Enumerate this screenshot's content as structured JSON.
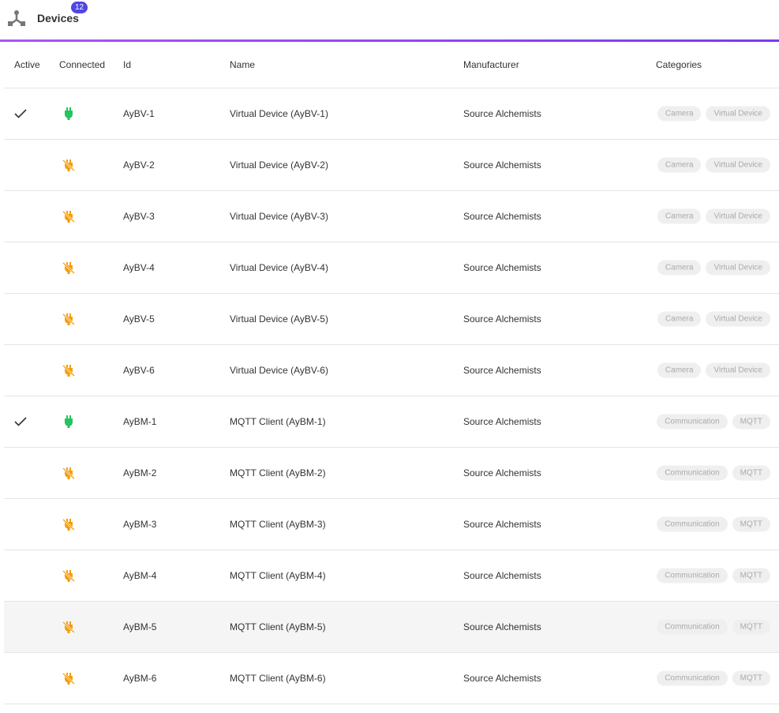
{
  "header": {
    "title": "Devices",
    "count": "12",
    "icon": "device-hub-icon"
  },
  "colors": {
    "accent": "#a855f7",
    "badge": "#4f46e5",
    "connected": "#22c55e",
    "disconnected": "#f59e0b"
  },
  "columns": [
    "Active",
    "Connected",
    "Id",
    "Name",
    "Manufacturer",
    "Categories"
  ],
  "rows": [
    {
      "active": true,
      "connected": true,
      "id": "AyBV-1",
      "name": "Virtual Device (AyBV-1)",
      "manufacturer": "Source Alchemists",
      "categories": [
        "Camera",
        "Virtual Device"
      ]
    },
    {
      "active": false,
      "connected": false,
      "id": "AyBV-2",
      "name": "Virtual Device (AyBV-2)",
      "manufacturer": "Source Alchemists",
      "categories": [
        "Camera",
        "Virtual Device"
      ]
    },
    {
      "active": false,
      "connected": false,
      "id": "AyBV-3",
      "name": "Virtual Device (AyBV-3)",
      "manufacturer": "Source Alchemists",
      "categories": [
        "Camera",
        "Virtual Device"
      ]
    },
    {
      "active": false,
      "connected": false,
      "id": "AyBV-4",
      "name": "Virtual Device (AyBV-4)",
      "manufacturer": "Source Alchemists",
      "categories": [
        "Camera",
        "Virtual Device"
      ]
    },
    {
      "active": false,
      "connected": false,
      "id": "AyBV-5",
      "name": "Virtual Device (AyBV-5)",
      "manufacturer": "Source Alchemists",
      "categories": [
        "Camera",
        "Virtual Device"
      ]
    },
    {
      "active": false,
      "connected": false,
      "id": "AyBV-6",
      "name": "Virtual Device (AyBV-6)",
      "manufacturer": "Source Alchemists",
      "categories": [
        "Camera",
        "Virtual Device"
      ]
    },
    {
      "active": true,
      "connected": true,
      "id": "AyBM-1",
      "name": "MQTT Client (AyBM-1)",
      "manufacturer": "Source Alchemists",
      "categories": [
        "Communication",
        "MQTT"
      ]
    },
    {
      "active": false,
      "connected": false,
      "id": "AyBM-2",
      "name": "MQTT Client (AyBM-2)",
      "manufacturer": "Source Alchemists",
      "categories": [
        "Communication",
        "MQTT"
      ]
    },
    {
      "active": false,
      "connected": false,
      "id": "AyBM-3",
      "name": "MQTT Client (AyBM-3)",
      "manufacturer": "Source Alchemists",
      "categories": [
        "Communication",
        "MQTT"
      ]
    },
    {
      "active": false,
      "connected": false,
      "id": "AyBM-4",
      "name": "MQTT Client (AyBM-4)",
      "manufacturer": "Source Alchemists",
      "categories": [
        "Communication",
        "MQTT"
      ]
    },
    {
      "active": false,
      "connected": false,
      "id": "AyBM-5",
      "name": "MQTT Client (AyBM-5)",
      "manufacturer": "Source Alchemists",
      "categories": [
        "Communication",
        "MQTT"
      ],
      "hovered": true
    },
    {
      "active": false,
      "connected": false,
      "id": "AyBM-6",
      "name": "MQTT Client (AyBM-6)",
      "manufacturer": "Source Alchemists",
      "categories": [
        "Communication",
        "MQTT"
      ]
    }
  ]
}
